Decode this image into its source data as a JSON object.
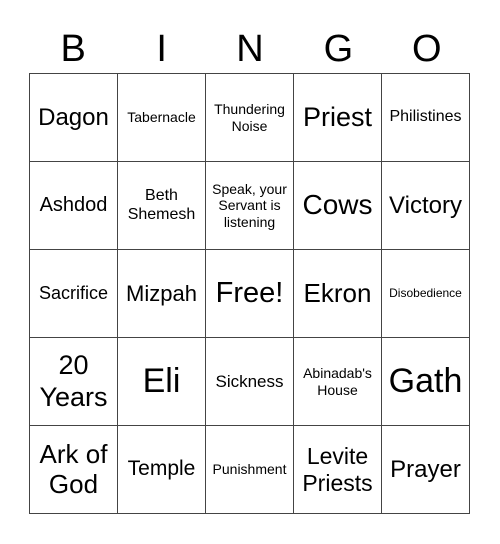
{
  "header": [
    "B",
    "I",
    "N",
    "G",
    "O"
  ],
  "cells": [
    [
      "Dagon",
      "Tabernacle",
      "Thundering Noise",
      "Priest",
      "Philistines"
    ],
    [
      "Ashdod",
      "Beth Shemesh",
      "Speak, your Servant is listening",
      "Cows",
      "Victory"
    ],
    [
      "Sacrifice",
      "Mizpah",
      "Free!",
      "Ekron",
      "Disobedience"
    ],
    [
      "20 Years",
      "Eli",
      "Sickness",
      "Abinadab's House",
      "Gath"
    ],
    [
      "Ark of God",
      "Temple",
      "Punishment",
      "Levite Priests",
      "Prayer"
    ]
  ]
}
